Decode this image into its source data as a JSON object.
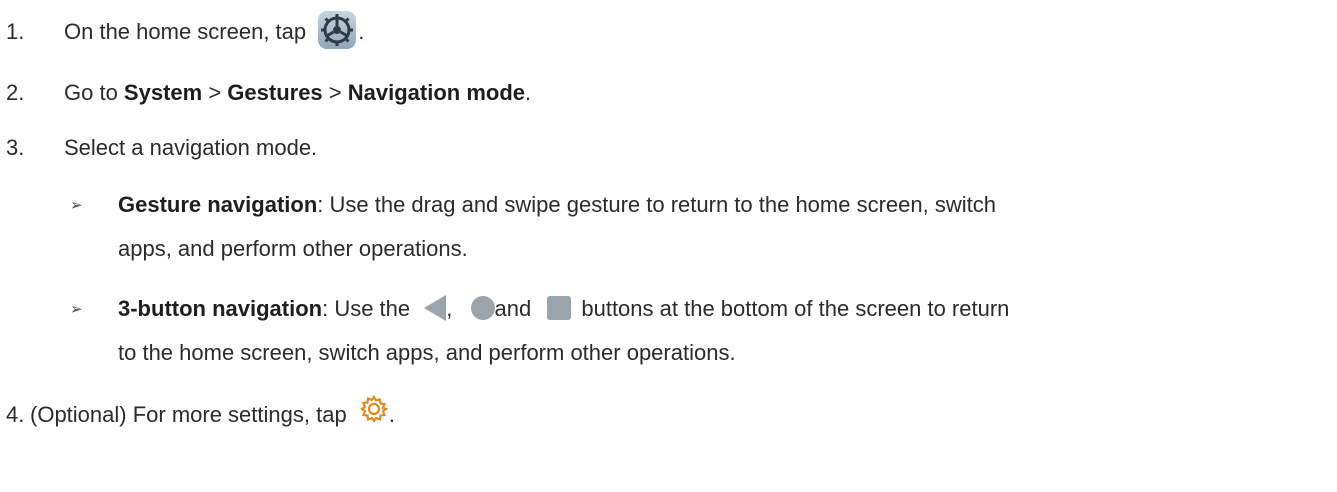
{
  "steps": [
    {
      "number": "1.",
      "text_before": "On the home screen, tap",
      "text_after": "."
    },
    {
      "number": "2.",
      "prefix": "Go to ",
      "path": [
        "System",
        "Gestures",
        "Navigation mode"
      ],
      "separator": " > ",
      "suffix": "."
    },
    {
      "number": "3.",
      "text": "Select a navigation mode."
    },
    {
      "number": "4.",
      "text_before": "(Optional) For more settings, tap",
      "text_after": "."
    }
  ],
  "bullets": [
    {
      "marker": "➢",
      "title": "Gesture navigation",
      "line1": ": Use the drag and swipe gesture to return to the home screen, switch",
      "line2": "apps, and perform other operations."
    },
    {
      "marker": "➢",
      "title": "3-button navigation",
      "line1_a": ": Use the",
      "line1_b": ",",
      "line1_c": "and",
      "line1_d": "buttons at the bottom of the screen to return",
      "line2": "to the home screen, switch apps, and perform other operations."
    }
  ],
  "icons": {
    "settings_app": "settings-app-gear-icon",
    "back": "back-triangle-icon",
    "home": "home-circle-icon",
    "recent": "recent-square-icon",
    "more_settings": "gear-icon",
    "nav_button_color": "#9aa4ad",
    "accent_color": "#e08a1e"
  }
}
